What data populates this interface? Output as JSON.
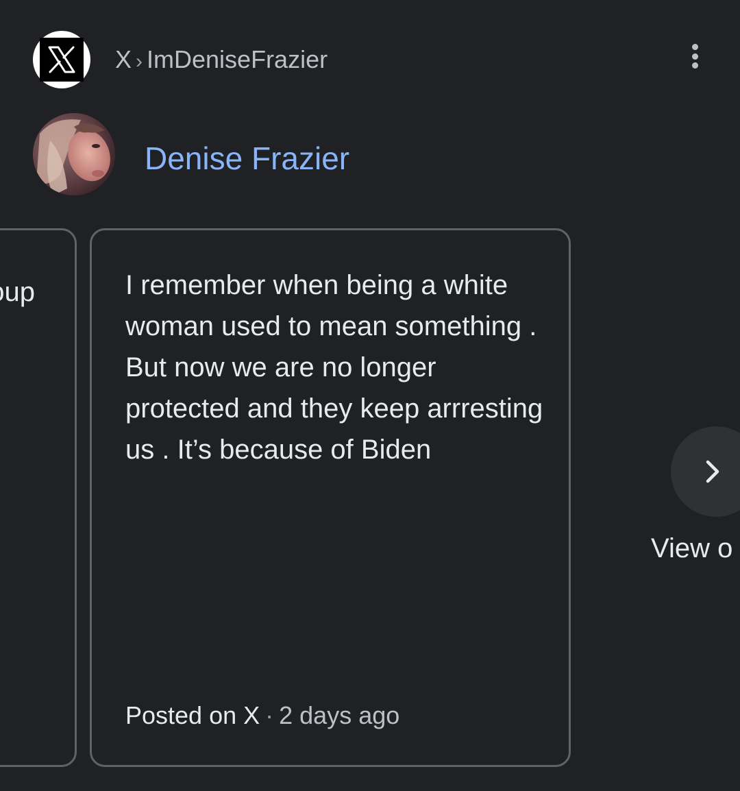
{
  "header": {
    "site_name": "X",
    "separator": "›",
    "account_handle": "ImDeniseFrazier",
    "site_logo_icon": "x-logo-icon",
    "menu_icon": "more-vertical-icon"
  },
  "author": {
    "name": "Denise Frazier",
    "avatar_icon": "profile-photo"
  },
  "carousel": {
    "previous_card_text": "oup",
    "current_post": {
      "text": "I remember when being a white woman used to mean something . But now we are no longer protected and they keep arrresting us . It’s because of Biden",
      "posted_on": "Posted on X",
      "separator": "·",
      "time_ago": "2 days ago"
    },
    "next_button_icon": "chevron-right-icon",
    "view_label": "View o"
  },
  "colors": {
    "background": "#202124",
    "link": "#8ab4f8",
    "text_primary": "#e8eaed",
    "text_secondary": "#bdc1c6",
    "card_border": "#5f6368",
    "button_bg": "#303134"
  }
}
